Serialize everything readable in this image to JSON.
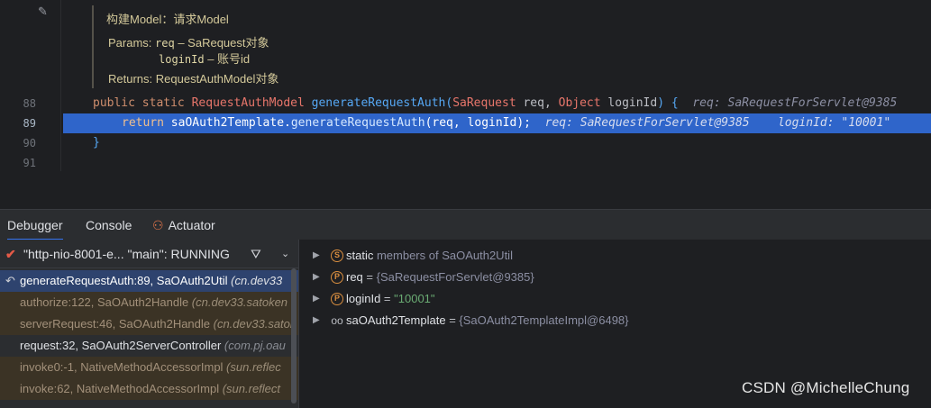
{
  "editor": {
    "line_numbers": [
      "88",
      "89",
      "90",
      "91"
    ],
    "doc": {
      "title": "构建Model：请求Model",
      "params_label": "Params:",
      "param1_name": "req",
      "param1_desc": " – SaRequest对象",
      "param2_name": "loginId",
      "param2_desc": " – 账号id",
      "returns_label": "Returns:",
      "returns_desc": "RequestAuthModel对象"
    },
    "line88": {
      "kw1": "public",
      "kw2": "static",
      "return_type": "RequestAuthModel",
      "method": "generateRequestAuth",
      "paren_open": "(",
      "p1_type": "SaRequest",
      "p1_name": " req, ",
      "p2_type": "Object",
      "p2_name": " loginId",
      "paren_close": ") ",
      "brace": "{",
      "hint": "req: SaRequestForServlet@9385"
    },
    "line89": {
      "kw": "return",
      "target": "saOAuth2Template",
      "dot": ".",
      "method": "generateRequestAuth",
      "args": "(req, loginId);",
      "hint1": "req: SaRequestForServlet@9385",
      "hint2": "loginId: \"10001\""
    },
    "line90": {
      "brace": "}"
    }
  },
  "debug": {
    "tabs": [
      "Debugger",
      "Console",
      "Actuator"
    ],
    "thread": "\"http-nio-8001-e... \"main\": RUNNING",
    "frames": [
      {
        "method": "generateRequestAuth:89, SaOAuth2Util",
        "pkg": " (cn.dev33"
      },
      {
        "method": "authorize:122, SaOAuth2Handle",
        "pkg": " (cn.dev33.satoken"
      },
      {
        "method": "serverRequest:46, SaOAuth2Handle",
        "pkg": " (cn.dev33.satok"
      },
      {
        "method": "request:32, SaOAuth2ServerController",
        "pkg": " (com.pj.oau"
      },
      {
        "method": "invoke0:-1, NativeMethodAccessorImpl",
        "pkg": " (sun.reflec"
      },
      {
        "method": "invoke:62, NativeMethodAccessorImpl",
        "pkg": " (sun.reflect"
      }
    ],
    "variables": [
      {
        "icon": "S",
        "name": "static",
        "rest": " members of SaOAuth2Util"
      },
      {
        "icon": "P",
        "name": "req",
        "eq": " = ",
        "value": "{SaRequestForServlet@9385}"
      },
      {
        "icon": "P",
        "name": "loginId",
        "eq": " = ",
        "value": "\"10001\""
      },
      {
        "icon": "oo",
        "name": "saOAuth2Template",
        "eq": " = ",
        "value": "{SaOAuth2TemplateImpl@6498}"
      }
    ]
  },
  "watermark": "CSDN @MichelleChung",
  "colors": {
    "execution_line": "#2f65ca",
    "selected_frame": "#2e436e",
    "accent": "#3574f0"
  }
}
